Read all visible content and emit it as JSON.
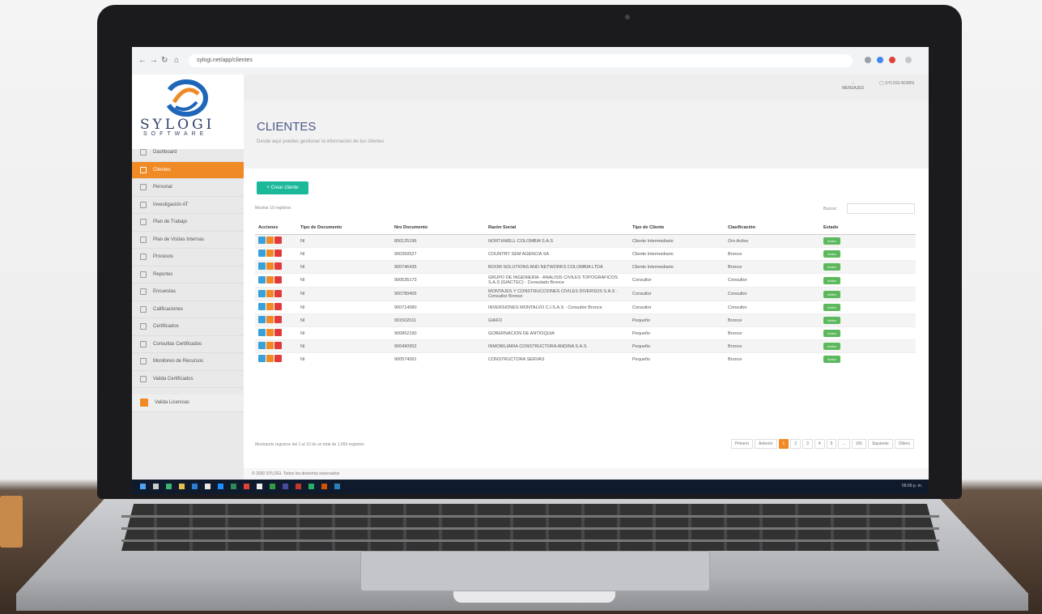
{
  "browser": {
    "url": "sylogi.net/app/clientes"
  },
  "brand": {
    "name": "SYLOGI",
    "sub": "SOFTWARE"
  },
  "header": {
    "user": "SYLOGI ADMIN",
    "icon_label": "MENSAJES"
  },
  "sidebar": {
    "items": [
      {
        "label": "Dashboard"
      },
      {
        "label": "Clientes"
      },
      {
        "label": "Personal"
      },
      {
        "label": "Investigación AT"
      },
      {
        "label": "Plan de Trabajo"
      },
      {
        "label": "Plan de Visitas Internas"
      },
      {
        "label": "Procesos"
      },
      {
        "label": "Reportes"
      },
      {
        "label": "Encuestas"
      },
      {
        "label": "Calificaciones"
      },
      {
        "label": "Certificados"
      },
      {
        "label": "Consultas Certificados"
      },
      {
        "label": "Monitoreo de Recursos"
      },
      {
        "label": "Valida Certificados"
      }
    ],
    "footer_item": {
      "label": "Valida Licencias"
    }
  },
  "page": {
    "title": "CLIENTES",
    "subtitle": "Desde aquí puedes gestionar la información de tus clientes",
    "new_button": "+ Crear cliente",
    "show_label": "Mostrar 10 registros",
    "search_label": "Buscar:"
  },
  "table": {
    "headers": [
      "Acciones",
      "Tipo de Documento",
      "Nro Documento",
      "Razón Social",
      "Tipo de Cliente",
      "Clasificación",
      "Estado"
    ],
    "rows": [
      {
        "tipo": "NI",
        "nro": "800125196",
        "razon": "NORTHWELL COLOMBIA S.A.S",
        "tipo_cliente": "Cliente Intermediario",
        "clasif": "Oro Activo",
        "estado": "Activo"
      },
      {
        "tipo": "NI",
        "nro": "900350527",
        "razon": "COUNTRY SEM AGENCIA SA",
        "tipo_cliente": "Cliente Intermediario",
        "clasif": "Bronce",
        "estado": "Activo"
      },
      {
        "tipo": "NI",
        "nro": "900746435",
        "razon": "BOOM SOLUTIONS AND NETWORKS COLOMBIA LTDA",
        "tipo_cliente": "Cliente Intermediario",
        "clasif": "Bronce",
        "estado": "Activo"
      },
      {
        "tipo": "NI",
        "nro": "900535173",
        "razon": "GRUPO DE INGENIERIA · ANALISIS CIVILES TOPOGRAFICOS S.A.S (GIACTEC) · Consulado Bronce",
        "tipo_cliente": "Consultor",
        "clasif": "Consultor",
        "estado": "Activo"
      },
      {
        "tipo": "NI",
        "nro": "900789405",
        "razon": "MONTAJES Y CONSTRUCCIONES CIVILES DIVERSOS S.A.S · Consultor Bronce",
        "tipo_cliente": "Consultor",
        "clasif": "Consultor",
        "estado": "Activo"
      },
      {
        "tipo": "NI",
        "nro": "900714580",
        "razon": "INVERSIONES MONTALVO C.I.S.A.S · Consultor Bronce",
        "tipo_cliente": "Consultor",
        "clasif": "Consultor",
        "estado": "Activo"
      },
      {
        "tipo": "NI",
        "nro": "901502011",
        "razon": "GIAFO",
        "tipo_cliente": "Pequeño",
        "clasif": "Bronce",
        "estado": "Activo"
      },
      {
        "tipo": "NI",
        "nro": "900852190",
        "razon": "GOBERNACION DE ANTIOQUIA",
        "tipo_cliente": "Pequeño",
        "clasif": "Bronce",
        "estado": "Activo"
      },
      {
        "tipo": "NI",
        "nro": "900490952",
        "razon": "INMOBILIARIA CONSTRUCTORA ANDINA S.A.S",
        "tipo_cliente": "Pequeño",
        "clasif": "Bronce",
        "estado": "Activo"
      },
      {
        "tipo": "NI",
        "nro": "900574091",
        "razon": "CONSTRUCTORA SERVAS",
        "tipo_cliente": "Pequeño",
        "clasif": "Bronce",
        "estado": "Activo"
      }
    ],
    "info": "Mostrando registros del 1 al 10 de un total de 1.650 registros",
    "pager": [
      "Primero",
      "Anterior",
      "1",
      "2",
      "3",
      "4",
      "5",
      "...",
      "165",
      "Siguiente",
      "Último"
    ]
  },
  "footer": {
    "text": "© 2020 SYLOGI. Todos los derechos reservados"
  },
  "taskbar": {
    "clock": "05:06 p. m."
  },
  "colors": {
    "accent": "#f08a24",
    "teal": "#1bb99a",
    "active_badge": "#5cb85c",
    "title": "#4a5a8a"
  }
}
